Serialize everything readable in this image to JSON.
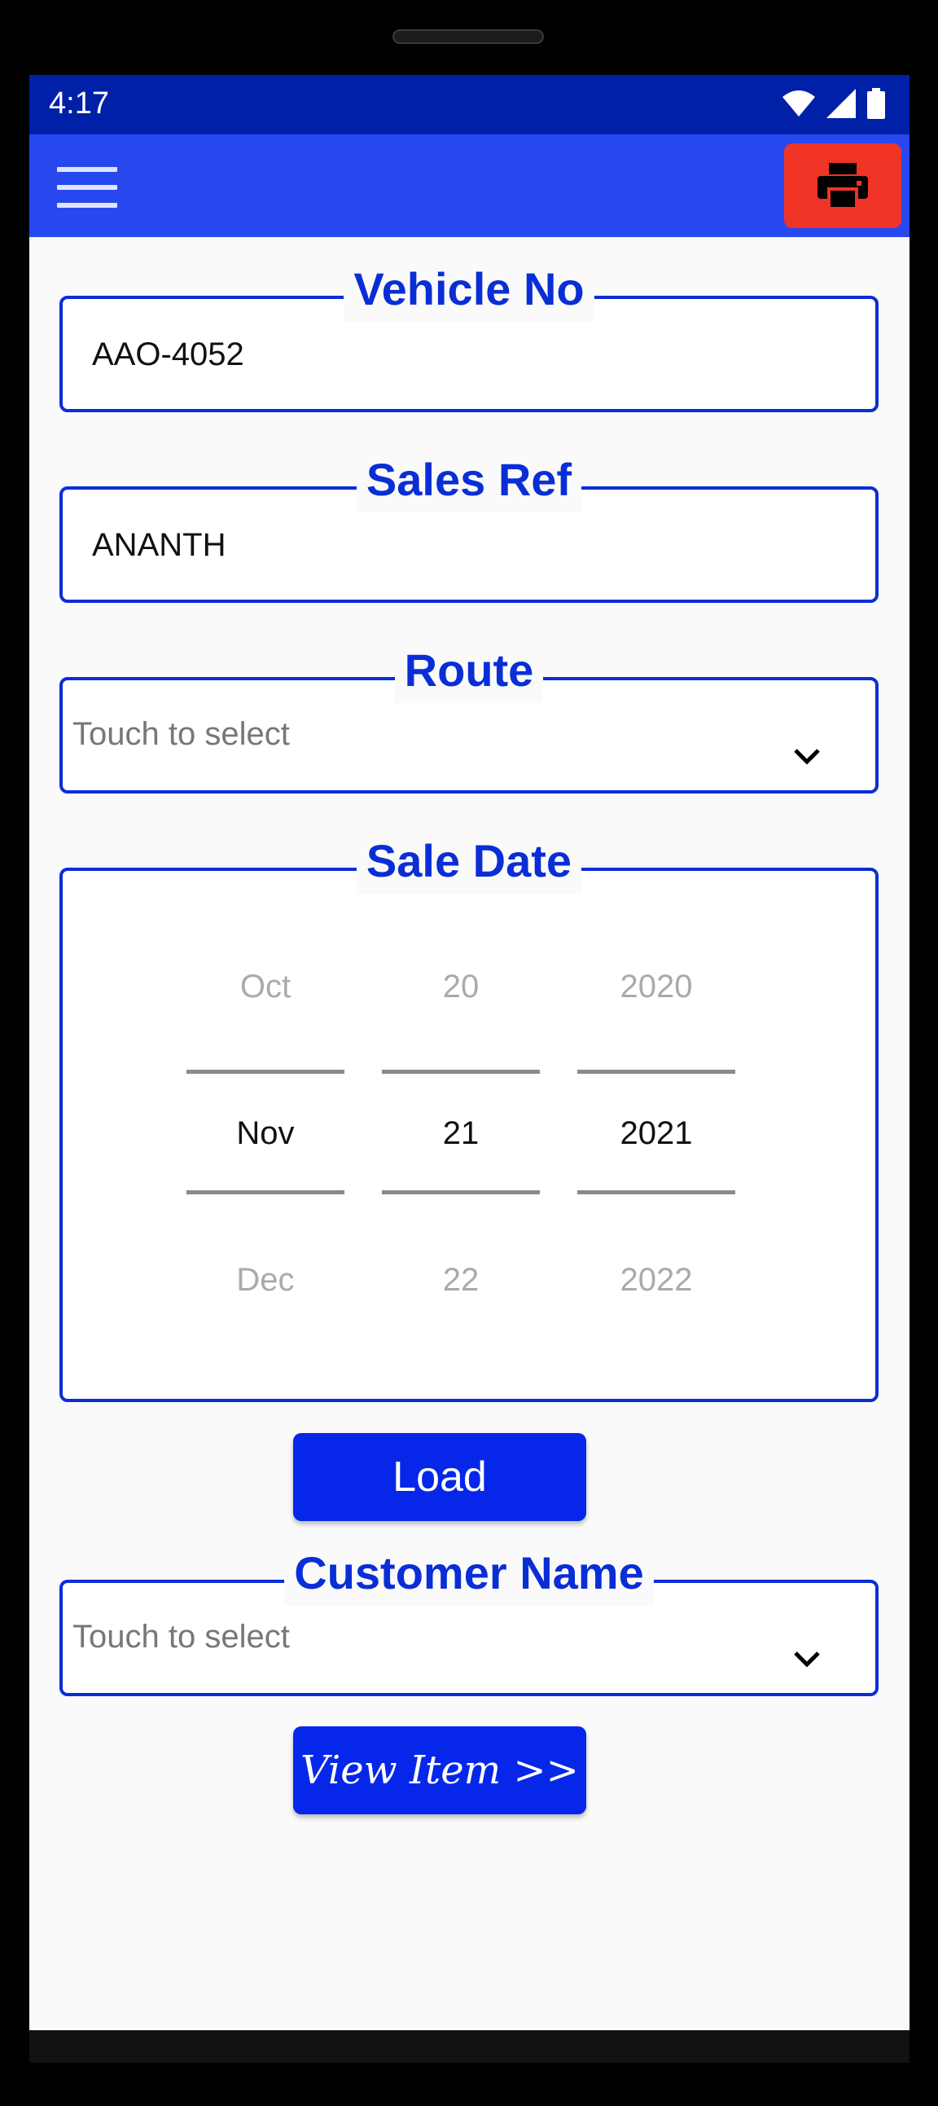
{
  "status_bar": {
    "time": "4:17"
  },
  "app_bar": {
    "menu_icon": "hamburger-menu-icon",
    "print_icon": "printer-icon"
  },
  "colors": {
    "primary": "#2748ef",
    "accent": "#ef3426",
    "field_border": "#0a2ed6",
    "button": "#0627ea"
  },
  "form": {
    "vehicle_no": {
      "label": "Vehicle No",
      "value": "AAO-4052"
    },
    "sales_ref": {
      "label": "Sales Ref",
      "value": "ANANTH"
    },
    "route": {
      "label": "Route",
      "placeholder": "Touch to select"
    },
    "sale_date": {
      "label": "Sale Date",
      "month": {
        "prev": "Oct",
        "selected": "Nov",
        "next": "Dec"
      },
      "day": {
        "prev": "20",
        "selected": "21",
        "next": "22"
      },
      "year": {
        "prev": "2020",
        "selected": "2021",
        "next": "2022"
      }
    },
    "load_button": "Load",
    "customer_name": {
      "label": "Customer Name",
      "placeholder": "Touch to select"
    },
    "view_item_button": "View Item >>"
  }
}
